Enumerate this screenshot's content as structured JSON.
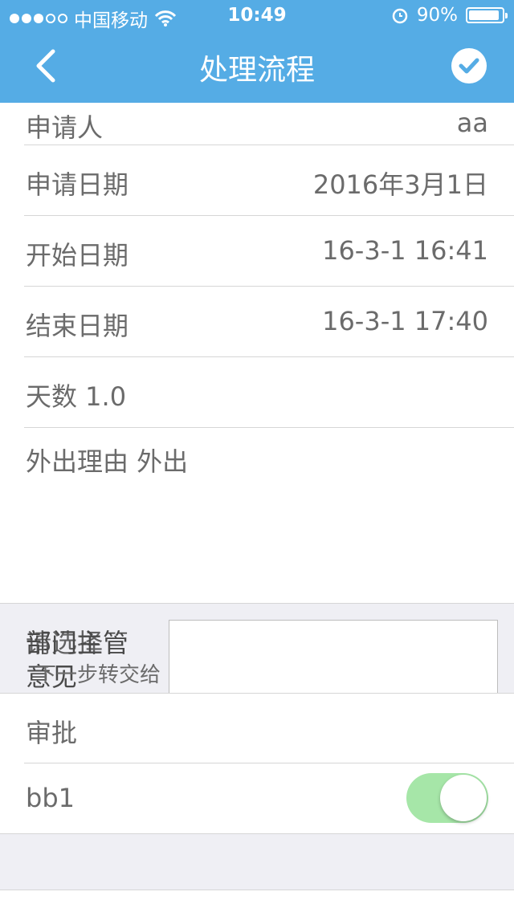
{
  "status_bar": {
    "carrier": "中国移动",
    "time": "10:49",
    "battery": "90%"
  },
  "nav": {
    "title": "处理流程"
  },
  "rows": {
    "applicant_label": "申请人",
    "applicant_value": "aa",
    "apply_date_label": "申请日期",
    "apply_date_value": "2016年3月1日",
    "start_date_label": "开始日期",
    "start_date_value": "16-3-1 16:41",
    "end_date_label": "结束日期",
    "end_date_value": "16-3-1 17:40",
    "days": "天数  1.0",
    "reason": "外出理由  外出"
  },
  "opinion": {
    "label_a": "部门主管",
    "label_b": "意见",
    "overlay_a": "请选择",
    "overlay_b": "下一步转交给"
  },
  "approval": {
    "label": "审批",
    "assignee": "bb1",
    "toggle_on": true
  },
  "colors": {
    "header_bg": "#55ace5",
    "toggle_on": "#a6e6a8",
    "page_gray": "#efeff4"
  }
}
